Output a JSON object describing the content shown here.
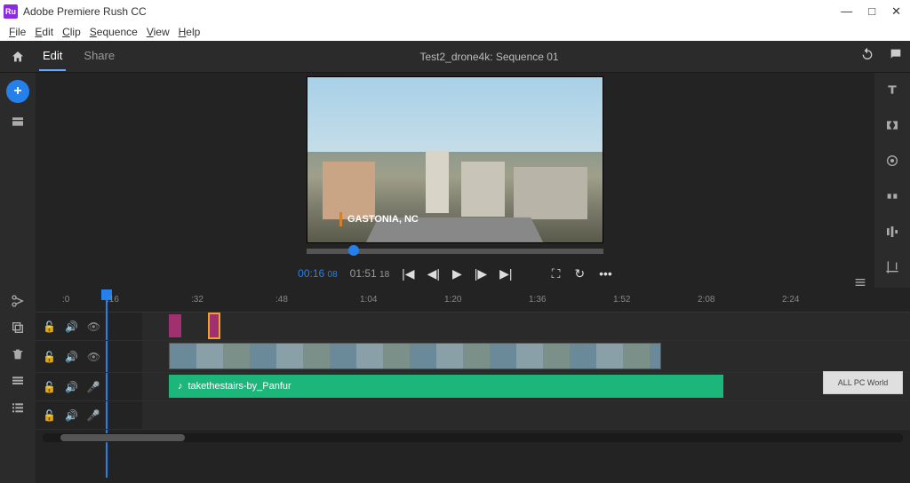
{
  "window": {
    "app_name": "Adobe Premiere Rush CC",
    "icon_label": "Ru"
  },
  "menubar": [
    "File",
    "Edit",
    "Clip",
    "Sequence",
    "View",
    "Help"
  ],
  "topbar": {
    "tab_edit": "Edit",
    "tab_share": "Share",
    "project_title": "Test2_drone4k: Sequence 01"
  },
  "preview": {
    "location_caption": "GASTONIA, NC"
  },
  "transport": {
    "current_time": "00:16",
    "current_frames": "08",
    "total_time": "01:51",
    "total_frames": "18"
  },
  "timeline": {
    "ruler": [
      ":0",
      ":16",
      ":32",
      ":48",
      "1:04",
      "1:20",
      "1:36",
      "1:52",
      "2:08",
      "2:24"
    ],
    "audio_clip_label": "takethestairs-by_Panfur"
  },
  "watermark": {
    "line1": "ALL PC World"
  }
}
